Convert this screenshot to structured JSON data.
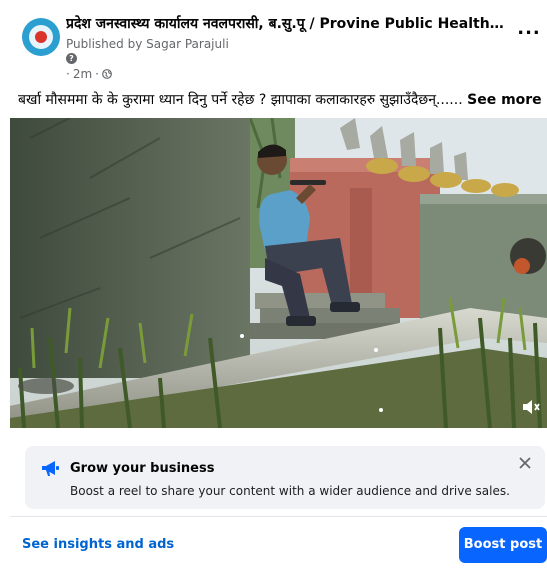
{
  "post": {
    "page_name": "प्रदेश जनस्वास्थ्य कार्यालय नवलपरासी, ब.सु.पू / Provine Public Health Off...",
    "published_prefix": "Published by",
    "published_by": "Sagar Parajuli",
    "time": "2m",
    "dot_separator": "·",
    "more_label": "...",
    "caption": "बर्खा मौसममा के के कुरामा ध्यान दिनु पर्ने रहेछ ? झापाका कलाकारहरु सुझाउँदैछन्......",
    "see_more": "See more"
  },
  "promo": {
    "title": "Grow your business",
    "description": "Boost a reel to share your content with a wider audience and drive sales."
  },
  "footer": {
    "insights_label": "See insights and ads",
    "boost_label": "Boost post"
  },
  "colors": {
    "accent": "#0866ff",
    "link": "#0064d1",
    "muted": "#65676b",
    "promo_bg": "#f0f2f5"
  },
  "icons": [
    "page-avatar",
    "help-icon",
    "globe-icon",
    "more-icon",
    "volume-muted-icon",
    "megaphone-icon",
    "close-icon"
  ]
}
